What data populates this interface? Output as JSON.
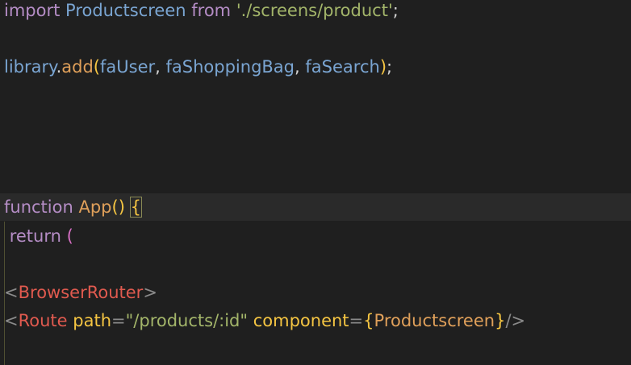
{
  "code": {
    "line1": {
      "kw_import": "import",
      "ident": "Productscreen",
      "kw_from": "from",
      "str": "'./screens/product'",
      "end": ";"
    },
    "line2": {
      "obj": "library",
      "dot": ".",
      "method": "add",
      "open": "(",
      "arg1": "faUser",
      "c1": ",",
      "arg2": "faShoppingBag",
      "c2": ",",
      "arg3": "faSearch",
      "close": ")",
      "end": ";"
    },
    "line3": {
      "kw_function": "function",
      "name": "App",
      "parens": "()",
      "brace": "{"
    },
    "line4": {
      "kw_return": "return",
      "paren": "("
    },
    "line5": {
      "lt": "<",
      "tag": "BrowserRouter",
      "gt": ">"
    },
    "line6": {
      "lt": "<",
      "tag": "Route",
      "attr1": "path",
      "eq1": "=",
      "val1": "\"/products/:id\"",
      "attr2": "component",
      "eq2": "=",
      "lbrace": "{",
      "val2": "Productscreen",
      "rbrace": "}",
      "close": "/>"
    }
  }
}
